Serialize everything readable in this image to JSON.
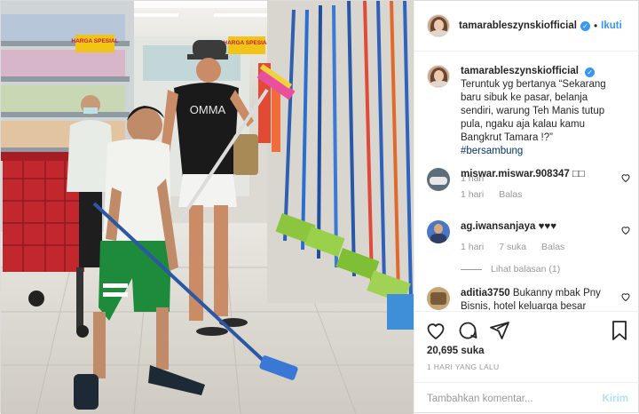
{
  "post": {
    "username": "tamarableszynskiofficial",
    "follow_label": "Ikuti",
    "photo_alt": "Foto postingan",
    "shop_signs": [
      "HARGA SPESIAL",
      "HARGA SPESIAL"
    ],
    "shirt_text": "OMMA"
  },
  "caption": {
    "username": "tamarableszynskiofficial",
    "text": "Teruntuk yg bertanya “Sekarang baru sibuk ke pasar, belanja sendiri, warung Teh Manis tutup pula, ngaku aja kalau kamu Bangkrut Tamara !?”",
    "hashtag": "#bersambung",
    "time": "1 hari"
  },
  "comments": [
    {
      "username": "miswar.miswar.908347",
      "text": "□□",
      "time": "1 hari",
      "reply_label": "Balas"
    },
    {
      "username": "ag.iwansanjaya",
      "text": "♥♥♥",
      "time": "1 hari",
      "likes": "7 suka",
      "reply_label": "Balas",
      "view_replies": "Lihat balasan (1)"
    },
    {
      "username": "aditia3750",
      "text": "Bukanny mbak Pny Bisnis, hotel keluarga besar"
    }
  ],
  "actions": {
    "icons": [
      "heart-icon",
      "comment-icon",
      "share-icon",
      "bookmark-icon"
    ],
    "likes": "20,695 suka",
    "date": "1 HARI YANG LALU"
  },
  "add_comment": {
    "placeholder": "Tambahkan komentar...",
    "post_label": "Kirim"
  },
  "colors": {
    "link": "#3897f0",
    "hashtag": "#003569",
    "muted": "#999999",
    "post_disabled": "#b2dffc"
  }
}
